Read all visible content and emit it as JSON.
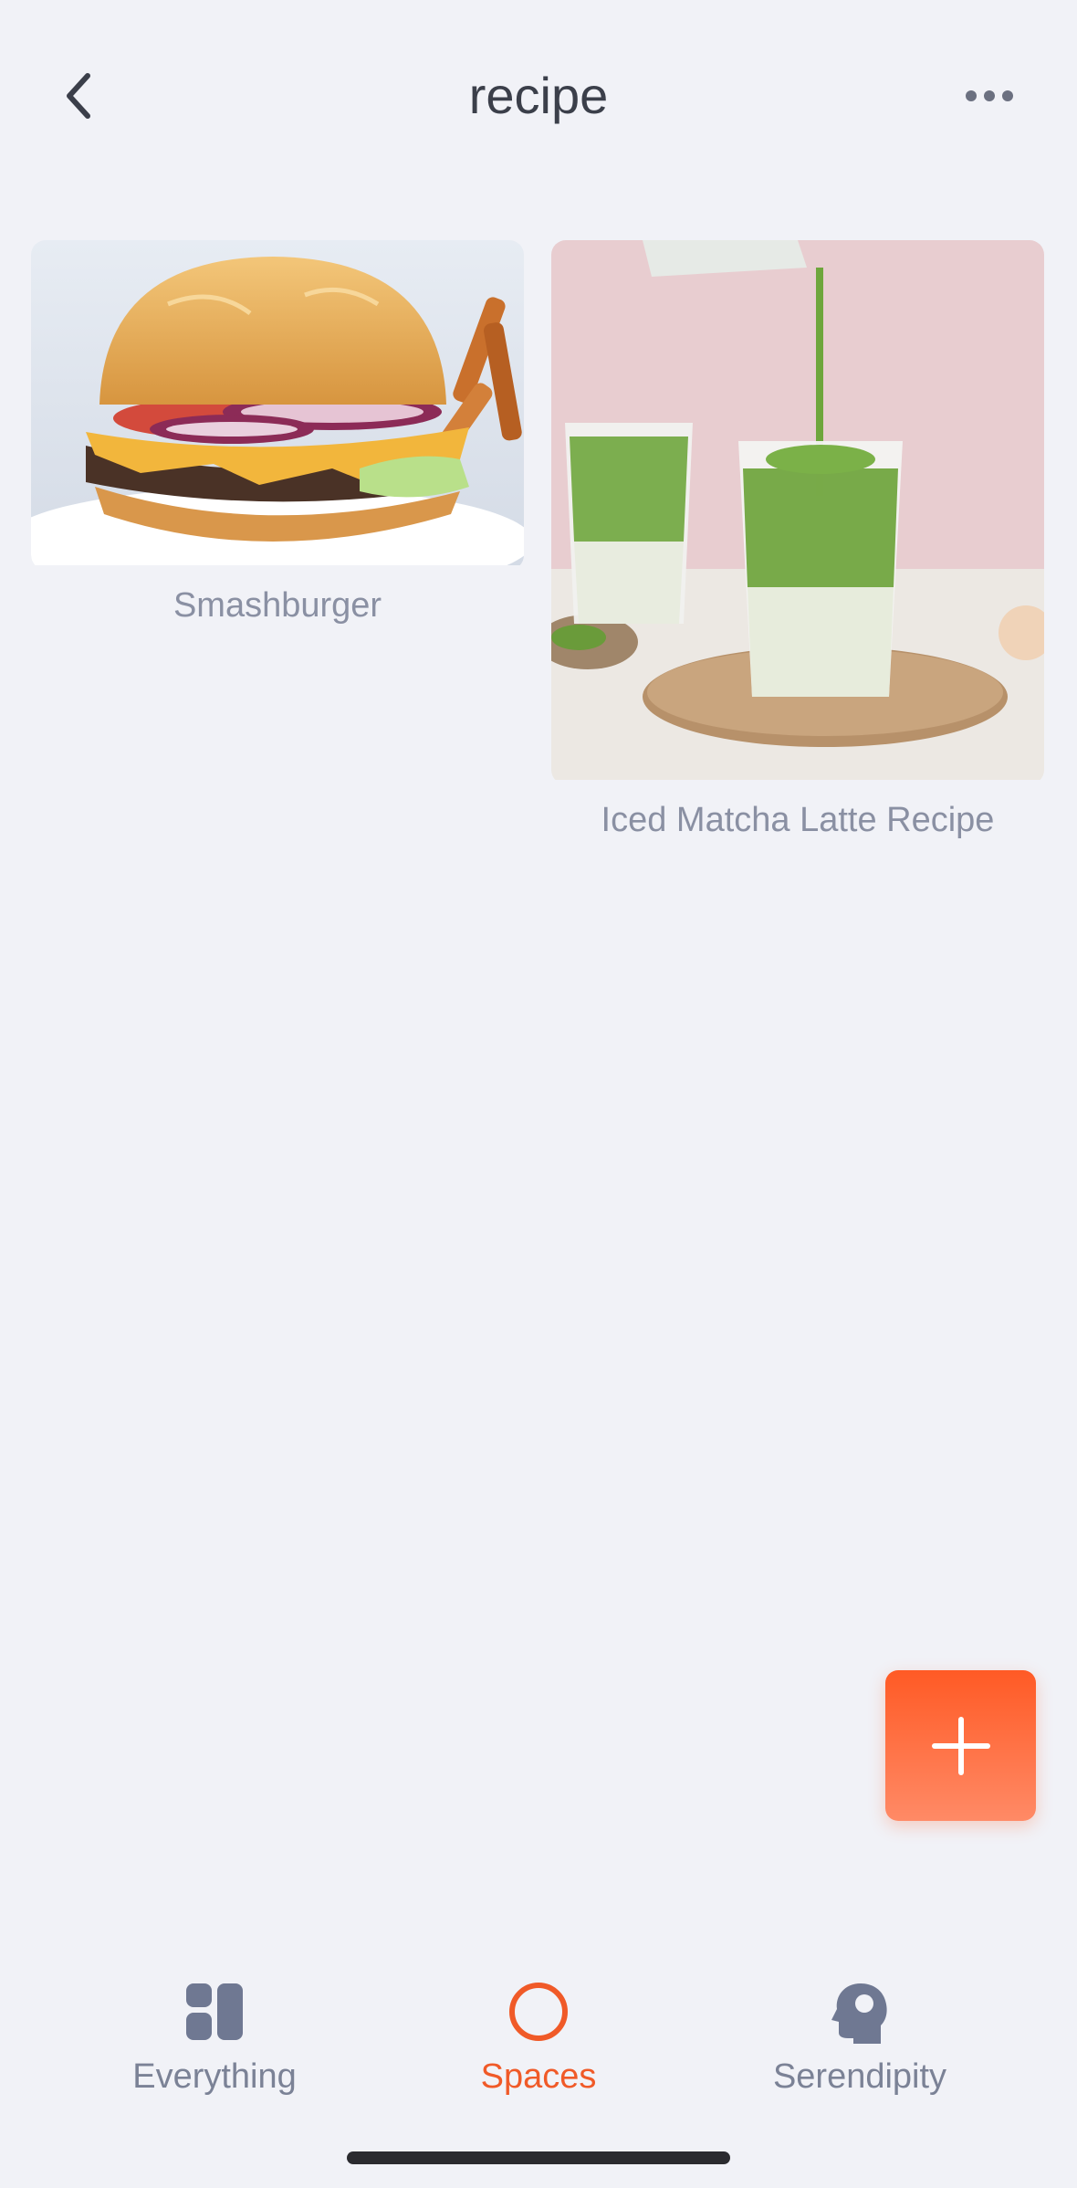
{
  "header": {
    "title": "recipe"
  },
  "items": [
    {
      "title": "Smashburger"
    },
    {
      "title": "Iced Matcha Latte Recipe"
    }
  ],
  "bottom_nav": {
    "items": [
      {
        "label": "Everything",
        "icon": "grid-icon",
        "active": false
      },
      {
        "label": "Spaces",
        "icon": "circle-icon",
        "active": true
      },
      {
        "label": "Serendipity",
        "icon": "head-icon",
        "active": false
      }
    ]
  },
  "colors": {
    "accent": "#f05a28",
    "inactive": "#7b8296",
    "background": "#f1f2f7"
  }
}
